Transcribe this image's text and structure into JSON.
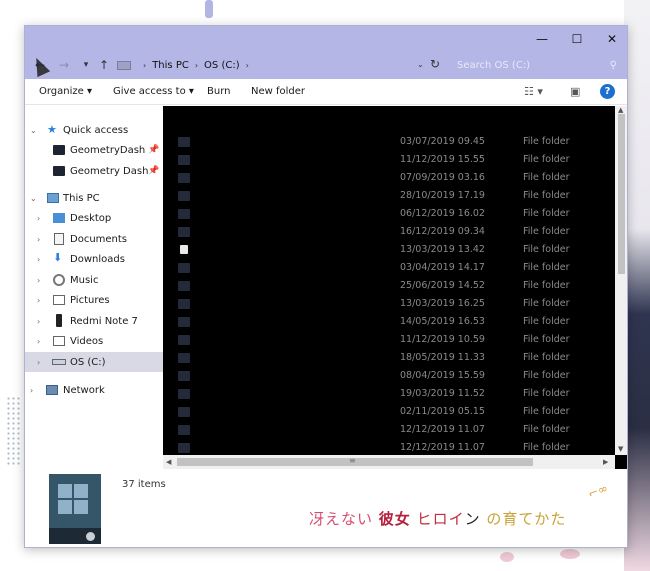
{
  "window": {
    "minimize_glyph": "—",
    "maximize_glyph": "☐",
    "close_glyph": "✕"
  },
  "address": {
    "back_glyph": "←",
    "forward_glyph": "→",
    "recent_glyph": "▾",
    "up_glyph": "↑",
    "sep_glyph": "›",
    "crumbs": [
      "This PC",
      "OS (C:)"
    ],
    "refresh_glyph": "↻",
    "dropdown_glyph": "⌄",
    "search_placeholder": "Search OS (C:)",
    "search_glyph": "⚲"
  },
  "toolbar": {
    "organize": "Organize ▾",
    "give_access": "Give access to ▾",
    "burn": "Burn",
    "new_folder": "New folder",
    "view_glyph": "☷ ▾",
    "preview_glyph": "▣",
    "help_glyph": "?"
  },
  "nav": {
    "chevron_open": "⌄",
    "chevron_closed": "›",
    "pin_glyph": "📌",
    "quick_access": "Quick access",
    "quick_items": [
      "GeometryDash",
      "Geometry Dash"
    ],
    "this_pc": "This PC",
    "pc_items": [
      "Desktop",
      "Documents",
      "Downloads",
      "Music",
      "Pictures",
      "Redmi Note 7",
      "Videos",
      "OS (C:)"
    ],
    "network": "Network"
  },
  "files": [
    {
      "date": "03/07/2019 09.45",
      "type": "File folder"
    },
    {
      "date": "11/12/2019 15.55",
      "type": "File folder"
    },
    {
      "date": "07/09/2019 03.16",
      "type": "File folder"
    },
    {
      "date": "28/10/2019 17.19",
      "type": "File folder"
    },
    {
      "date": "06/12/2019 16.02",
      "type": "File folder"
    },
    {
      "date": "16/12/2019 09.34",
      "type": "File folder"
    },
    {
      "date": "13/03/2019 13.42",
      "type": "File folder"
    },
    {
      "date": "03/04/2019 14.17",
      "type": "File folder"
    },
    {
      "date": "25/06/2019 14.52",
      "type": "File folder"
    },
    {
      "date": "13/03/2019 16.25",
      "type": "File folder"
    },
    {
      "date": "14/05/2019 16.53",
      "type": "File folder"
    },
    {
      "date": "11/12/2019 10.59",
      "type": "File folder"
    },
    {
      "date": "18/05/2019 11.33",
      "type": "File folder"
    },
    {
      "date": "08/04/2019 15.59",
      "type": "File folder"
    },
    {
      "date": "19/03/2019 11.52",
      "type": "File folder"
    },
    {
      "date": "02/11/2019 05.15",
      "type": "File folder"
    },
    {
      "date": "12/12/2019 11.07",
      "type": "File folder"
    },
    {
      "date": "12/12/2019 11.07",
      "type": "File folder"
    }
  ],
  "scroll": {
    "up": "▲",
    "down": "▼",
    "left": "◀",
    "right": "▶",
    "grip": "≡"
  },
  "details": {
    "items_count": "37 items",
    "jp_1": "冴えない",
    "jp_2": "彼女",
    "jp_3": "ヒロイ",
    "jp_4": "ン",
    "jp_5": "の育てかた",
    "glasses_glyph": "⌐∞"
  }
}
